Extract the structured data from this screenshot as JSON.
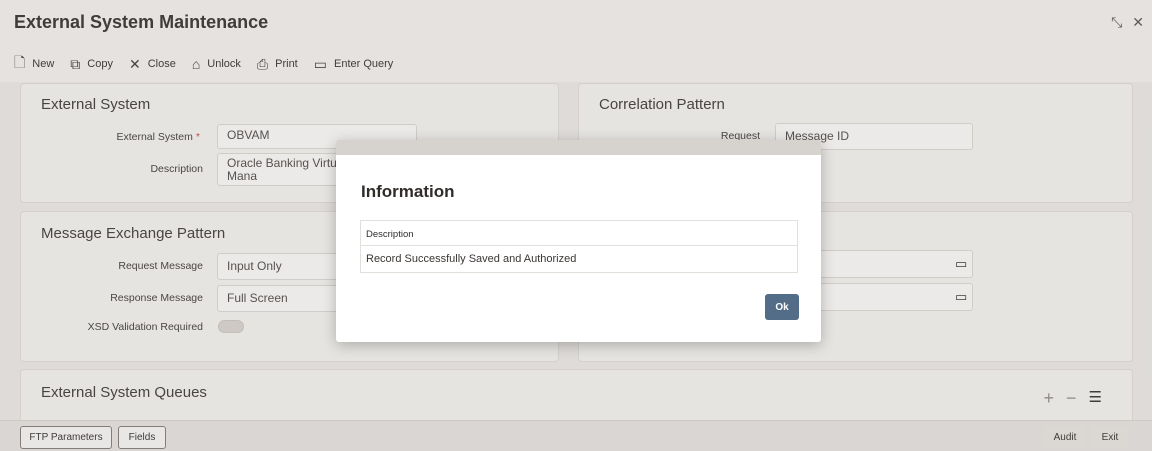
{
  "window": {
    "title": "External System Maintenance",
    "restore_icon": "restore-icon",
    "close_icon": "close-icon"
  },
  "toolbar": {
    "items": [
      {
        "label": "New",
        "icon": "new-document-icon"
      },
      {
        "label": "Copy",
        "icon": "copy-icon"
      },
      {
        "label": "Close",
        "icon": "close-x-icon"
      },
      {
        "label": "Unlock",
        "icon": "unlock-icon"
      },
      {
        "label": "Print",
        "icon": "printer-icon"
      },
      {
        "label": "Enter Query",
        "icon": "query-icon"
      }
    ]
  },
  "external_system": {
    "title": "External System",
    "external_system_label": "External System",
    "external_system_value": "OBVAM",
    "description_label": "Description",
    "description_value_line1": "Oracle Banking Virtua",
    "description_value_line2": "Mana"
  },
  "correlation": {
    "title": "Correlation Pattern",
    "request_label": "Request",
    "request_value": "Message ID"
  },
  "message_exchange": {
    "title": "Message Exchange Pattern",
    "request_message_label": "Request Message",
    "request_message_value": "Input Only",
    "response_message_label": "Response Message",
    "response_message_value": "Full Screen",
    "xsd_label": "XSD Validation Required",
    "xsd_enabled": false
  },
  "queues": {
    "title": "External System Queues"
  },
  "bottom": {
    "ftp_label": "FTP Parameters",
    "fields_label": "Fields",
    "audit_label": "Audit",
    "exit_label": "Exit"
  },
  "dialog": {
    "title": "Information",
    "column_header": "Description",
    "message": "Record Successfully Saved and Authorized",
    "ok_label": "Ok"
  },
  "colors": {
    "accent": "#536c88",
    "required": "#c74634"
  }
}
